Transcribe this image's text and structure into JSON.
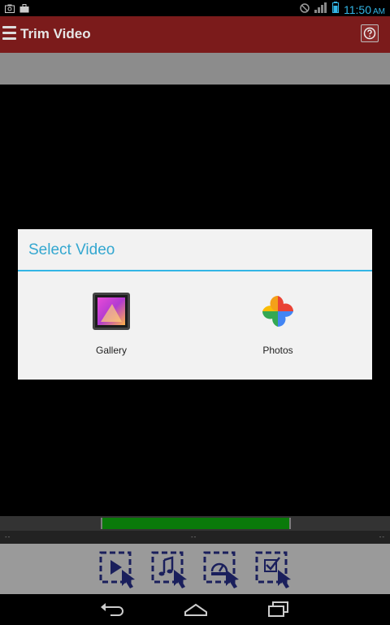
{
  "status_bar": {
    "left_icons": [
      "screenshot-icon",
      "briefcase-icon"
    ],
    "right_icons": [
      "blocked-icon",
      "signal-icon",
      "battery-icon"
    ],
    "time": "11:50",
    "ampm": "AM"
  },
  "app_bar": {
    "title": "Trim Video",
    "menu_icon": "hamburger-menu-icon",
    "help_icon": "help-icon"
  },
  "dialog": {
    "title": "Select Video",
    "options": [
      {
        "label": "Gallery",
        "icon": "gallery-icon"
      },
      {
        "label": "Photos",
        "icon": "google-photos-icon"
      }
    ]
  },
  "timeline": {
    "start_label": "--",
    "mid_label": "--",
    "end_label": "--"
  },
  "toolbar": {
    "buttons": [
      "trim-play-icon",
      "music-icon",
      "speed-icon",
      "save-check-icon"
    ]
  },
  "nav_bar": {
    "buttons": [
      "back-icon",
      "home-icon",
      "recents-icon"
    ]
  },
  "colors": {
    "app_bar": "#7b1b1b",
    "accent": "#33b5e5",
    "selection": "#0a7a0a",
    "toolbar": "#9a9a9a",
    "toolbar_icon": "#1a1f5c"
  }
}
